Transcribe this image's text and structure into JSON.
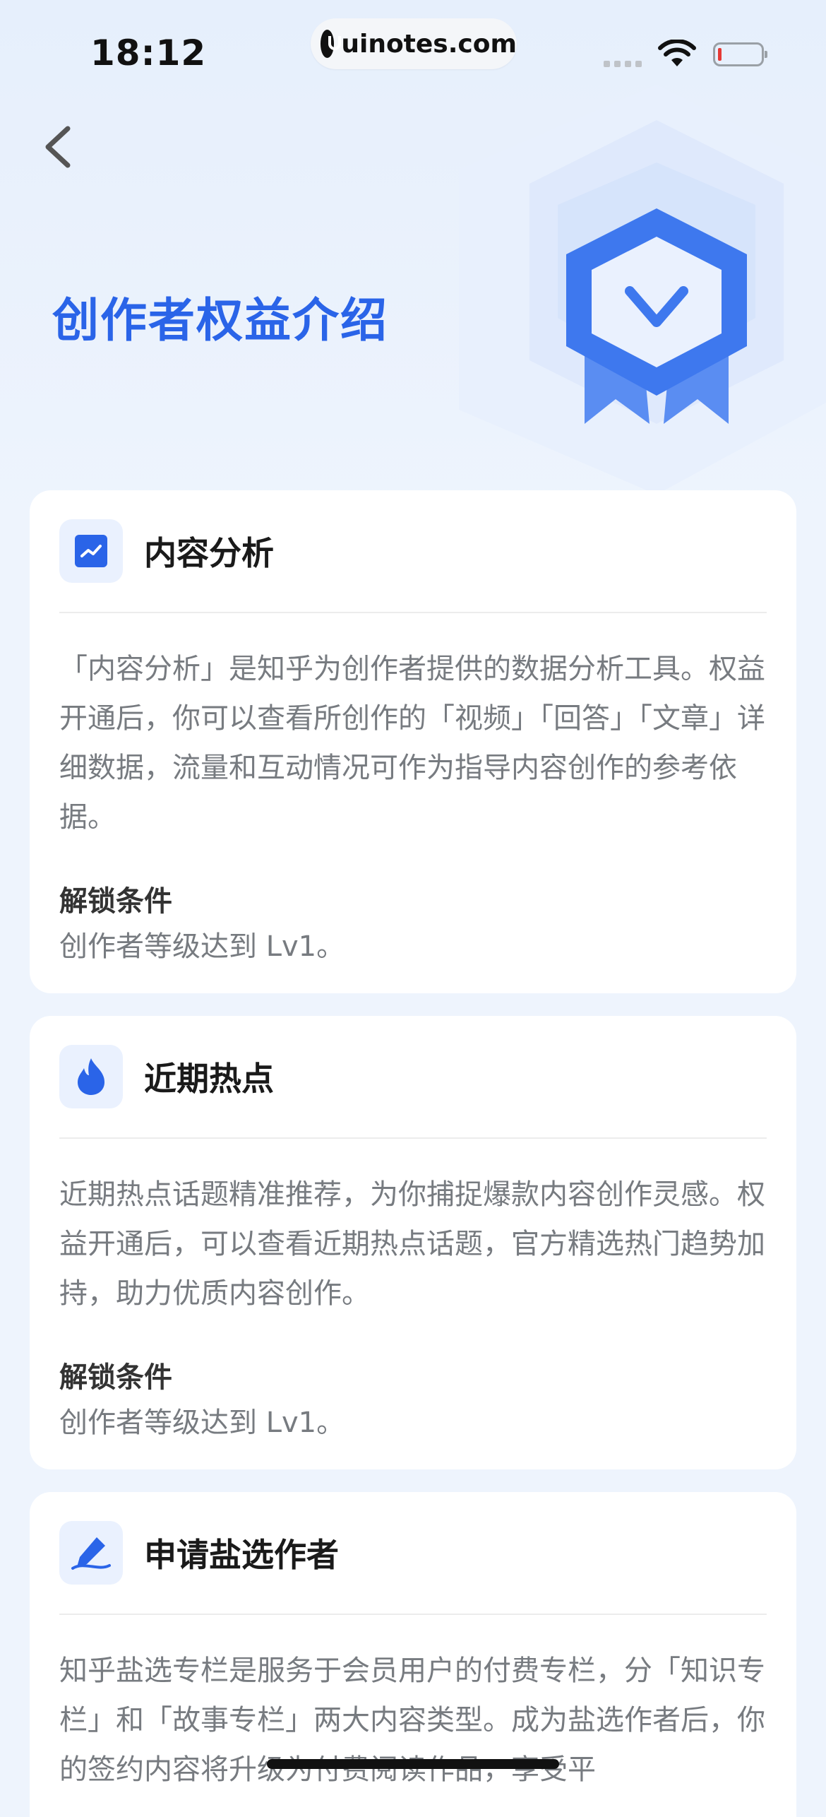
{
  "status_bar": {
    "time": "18:12",
    "url": "uinotes.com"
  },
  "header": {
    "back_icon": "chevron-left-icon",
    "title": "创作者权益介绍",
    "hero_icon": "badge-v-medal-icon"
  },
  "colors": {
    "accent": "#2a64e8",
    "background": "#eef4fd",
    "card": "#ffffff",
    "body_text": "#777b80"
  },
  "cards": [
    {
      "icon": "trend-chart-icon",
      "title": "内容分析",
      "description": "「内容分析」是知乎为创作者提供的数据分析工具。权益开通后，你可以查看所创作的「视频」「回答」「文章」详细数据，流量和互动情况可作为指导内容创作的参考依据。",
      "condition_label": "解锁条件",
      "condition_text": "创作者等级达到 Lv1。"
    },
    {
      "icon": "flame-icon",
      "title": "近期热点",
      "description": "近期热点话题精准推荐，为你捕捉爆款内容创作灵感。权益开通后，可以查看近期热点话题，官方精选热门趋势加持，助力优质内容创作。",
      "condition_label": "解锁条件",
      "condition_text": "创作者等级达到 Lv1。"
    },
    {
      "icon": "pen-icon",
      "title": "申请盐选作者",
      "description": "知乎盐选专栏是服务于会员用户的付费专栏，分「知识专栏」和「故事专栏」两大内容类型。成为盐选作者后，你的签约内容将升级为付费阅读作品，享受平"
    }
  ]
}
